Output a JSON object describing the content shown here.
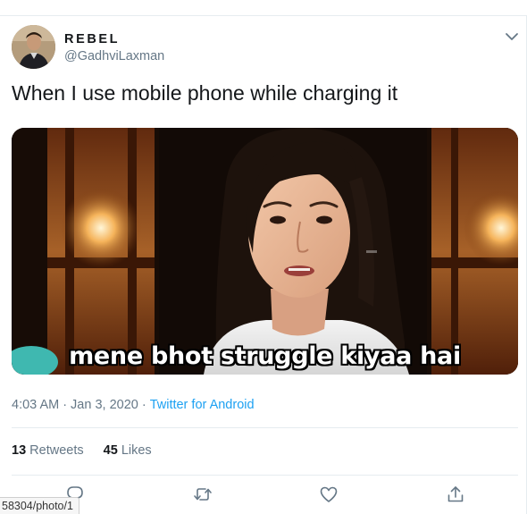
{
  "user": {
    "display_name": "REBEL",
    "handle": "@GadhviLaxman"
  },
  "tweet": {
    "text": "When I use mobile phone while charging it",
    "media_caption": "mene bhot struggle kiyaa hai",
    "time": "4:03 AM",
    "separator": "·",
    "date": "Jan 3, 2020",
    "source": "Twitter for Android"
  },
  "stats": {
    "retweets_count": "13",
    "retweets_label": "Retweets",
    "likes_count": "45",
    "likes_label": "Likes"
  },
  "actions": [
    "reply-icon",
    "retweet-icon",
    "like-icon",
    "share-icon"
  ],
  "status_bar": {
    "url": "58304/photo/1"
  },
  "colors": {
    "text_primary": "#14171a",
    "text_secondary": "#657786",
    "link": "#1da1f2",
    "divider": "#e6ecf0"
  }
}
